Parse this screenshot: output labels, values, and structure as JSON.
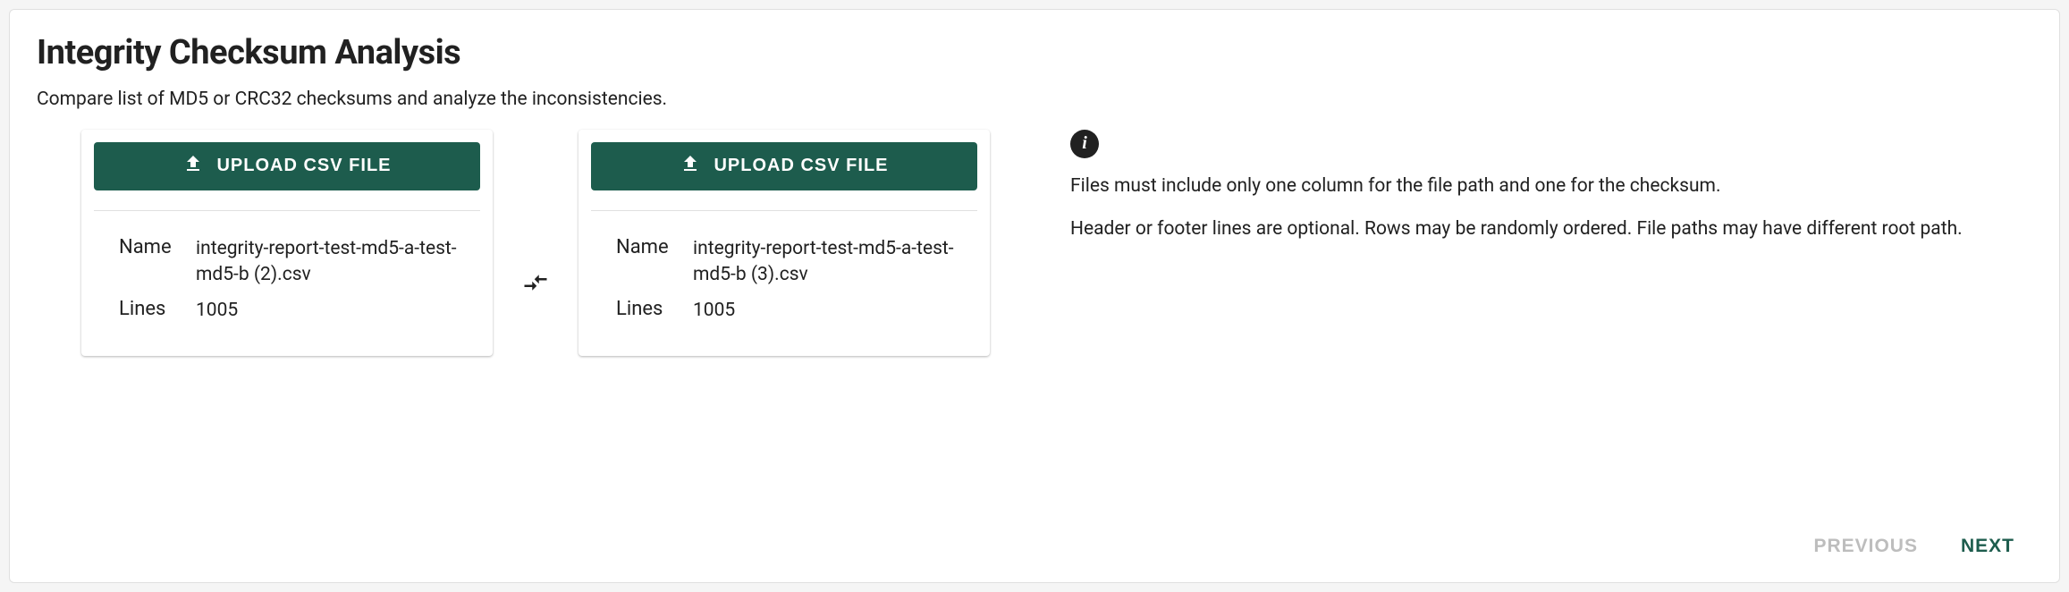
{
  "header": {
    "title": "Integrity Checksum Analysis",
    "subtitle": "Compare list of MD5 or CRC32 checksums and analyze the inconsistencies."
  },
  "upload_button_label": "UPLOAD CSV FILE",
  "labels": {
    "name": "Name",
    "lines": "Lines"
  },
  "files": {
    "left": {
      "name": "integrity-report-test-md5-a-test-md5-b (2).csv",
      "lines": "1005"
    },
    "right": {
      "name": "integrity-report-test-md5-a-test-md5-b (3).csv",
      "lines": "1005"
    }
  },
  "info": {
    "line1": "Files must include only one column for the file path and one for the checksum.",
    "line2": "Header or footer lines are optional. Rows may be randomly ordered. File paths may have different root path."
  },
  "nav": {
    "previous": "PREVIOUS",
    "next": "NEXT"
  }
}
